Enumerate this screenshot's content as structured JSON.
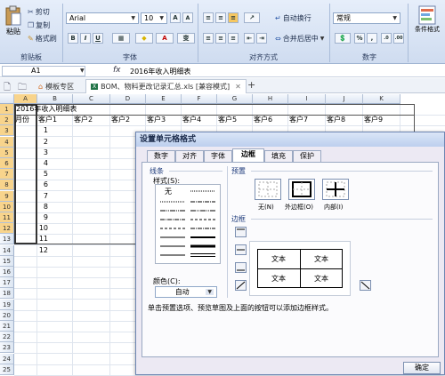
{
  "ribbon": {
    "clipboard": {
      "paste": "粘贴",
      "cut": "剪切",
      "copy": "复制",
      "format_painter": "格式刷",
      "group": "剪贴板"
    },
    "font": {
      "name": "Arial",
      "size": "10",
      "group": "字体",
      "bold": "B",
      "italic": "I",
      "underline": "U",
      "grow": "A",
      "shrink": "A",
      "phonetic": "变"
    },
    "alignment": {
      "wrap_text": "自动换行",
      "merge_center": "合并后居中",
      "group": "对齐方式"
    },
    "number": {
      "format": "常规",
      "percent": "%",
      "comma": ",",
      "group": "数字"
    },
    "styles": {
      "conditional": "条件格式"
    }
  },
  "formula_bar": {
    "name_box": "A1",
    "fx": "fx",
    "value": "2016年收入明细表"
  },
  "workbook_tabs": [
    {
      "label": "模板专区"
    },
    {
      "label": "BOM、物料更改记录汇总.xls [兼容模式]"
    },
    {
      "label": "+"
    }
  ],
  "columns": [
    "A",
    "B",
    "C",
    "D",
    "E",
    "F",
    "G",
    "H",
    "I",
    "J",
    "K"
  ],
  "rows": [
    "1",
    "2",
    "3",
    "4",
    "5",
    "6",
    "7",
    "8",
    "9",
    "10",
    "11",
    "12",
    "13",
    "14",
    "15",
    "16",
    "17",
    "18",
    "19",
    "20",
    "21",
    "22",
    "23",
    "24",
    "25"
  ],
  "sheet": {
    "title": "2016年收入明细表",
    "headers": [
      "月份",
      "客户1",
      "客户2",
      "客户2",
      "客户3",
      "客户4",
      "客户5",
      "客户6",
      "客户7",
      "客户8",
      "客户9"
    ],
    "months": [
      "1",
      "2",
      "3",
      "4",
      "5",
      "6",
      "7",
      "8",
      "9",
      "10",
      "11",
      "12"
    ]
  },
  "dialog": {
    "title": "设置单元格格式",
    "tabs": [
      "数字",
      "对齐",
      "字体",
      "边框",
      "填充",
      "保护"
    ],
    "active_tab": "边框",
    "line_section": "线条",
    "style_label": "样式(S):",
    "none_style": "无",
    "color_label": "颜色(C):",
    "color_value": "自动",
    "preset_section": "预置",
    "presets": [
      "无(N)",
      "外边框(O)",
      "内部(I)"
    ],
    "border_section": "边框",
    "preview_text": [
      "文本",
      "文本",
      "文本",
      "文本"
    ],
    "hint": "单击预置选项、预览草图及上面的按钮可以添加边框样式。",
    "ok": "确定"
  }
}
